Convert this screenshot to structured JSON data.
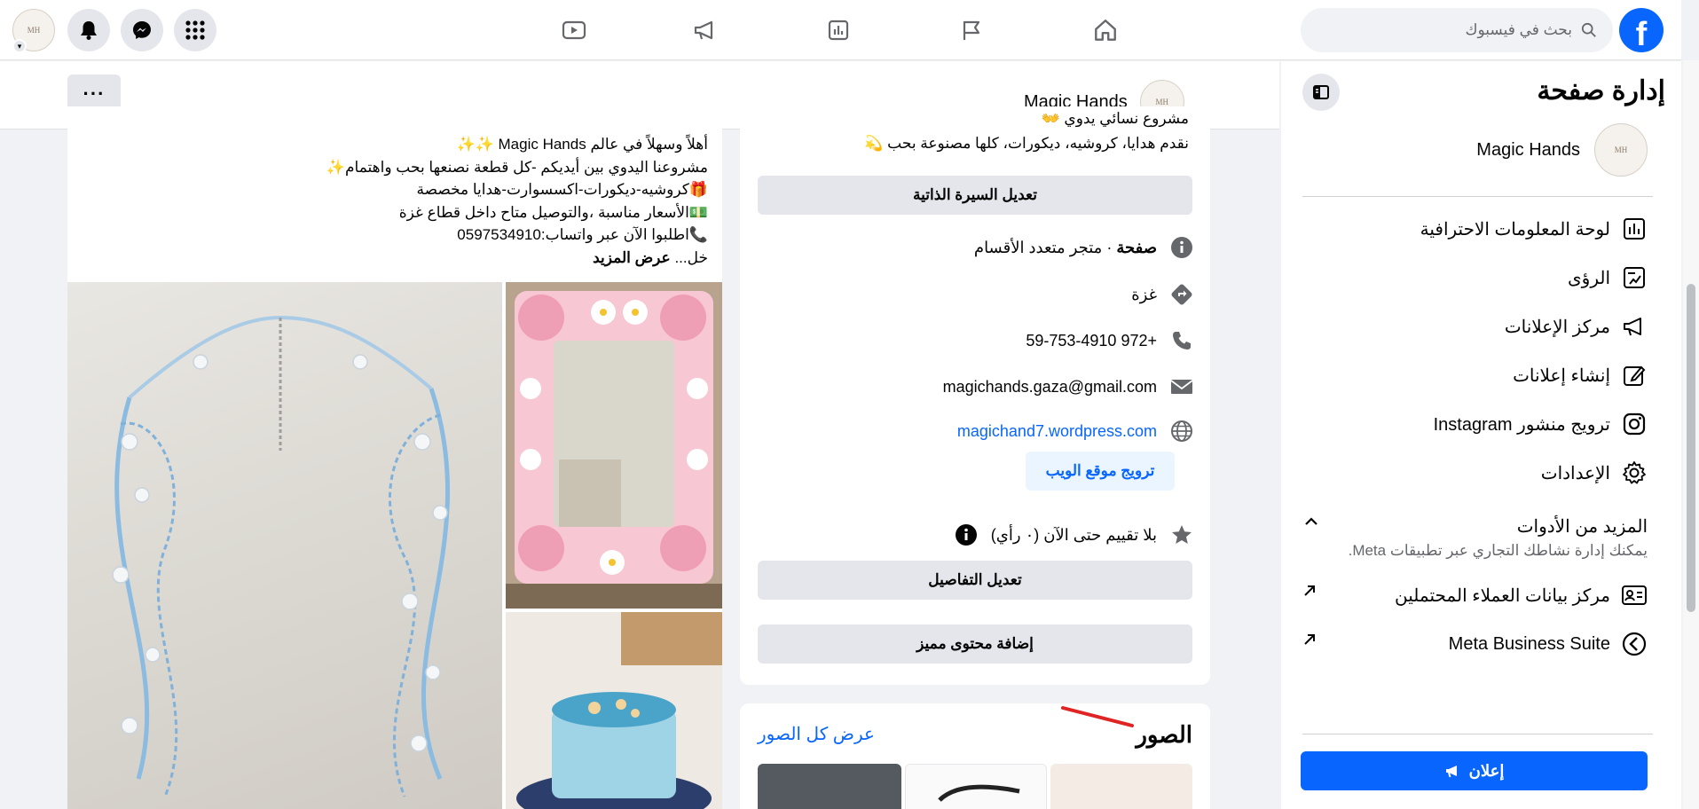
{
  "topbar": {
    "search_placeholder": "بحث في فيسبوك",
    "logo_letter": "f"
  },
  "sidebar": {
    "title": "إدارة صفحة",
    "page_name": "Magic Hands",
    "items": [
      {
        "label": "لوحة المعلومات الاحترافية",
        "icon": "dashboard-icon"
      },
      {
        "label": "الرؤى",
        "icon": "insights-icon"
      },
      {
        "label": "مركز الإعلانات",
        "icon": "megaphone-icon"
      },
      {
        "label": "إنشاء إعلانات",
        "icon": "pencil-icon"
      },
      {
        "label": "ترويج منشور Instagram",
        "icon": "instagram-icon"
      },
      {
        "label": "الإعدادات",
        "icon": "gear-icon"
      }
    ],
    "more_tools_title": "المزيد من الأدوات",
    "more_tools_sub": "يمكنك إدارة نشاطك التجاري عبر تطبيقات Meta.",
    "lead_center": "مركز بيانات العملاء المحتملين",
    "business_suite": "Meta Business Suite",
    "ad_button": "إعلان"
  },
  "page_header": {
    "name": "Magic Hands",
    "more": "···"
  },
  "intro": {
    "bio_line1": "مشروع نسائي يدوي 👐",
    "bio_line2": "نقدم هدايا، كروشيه، ديكورات، كلها مصنوعة بحب 💫",
    "edit_bio": "تعديل السيرة الذاتية",
    "category_prefix": "صفحة",
    "category": " · متجر متعدد الأقسام",
    "location": "غزة",
    "phone": "+972 59-753-4910",
    "email": "magichands.gaza@gmail.com",
    "website": "magichand7.wordpress.com",
    "promote_website": "ترويج موقع الويب",
    "rating": "بلا تقييم حتى الآن (٠ رأي)",
    "edit_details": "تعديل التفاصيل",
    "add_featured": "إضافة محتوى مميز"
  },
  "photos": {
    "title": "الصور",
    "see_all": "عرض كل الصور"
  },
  "post": {
    "lines": [
      "أهلاً وسهلاً في عالم Magic Hands ✨✨",
      "مشروعنا اليدوي بين أيديكم -كل قطعة نصنعها بحب واهتمام✨",
      "🎁كروشيه-ديكورات-اكسسوارت-هدايا مخصصة",
      "💵الأسعار مناسبة ،والتوصيل متاح داخل قطاع غزة",
      "📞اطلبوا الآن عبر واتساب:0597534910"
    ],
    "truncated": "خل...",
    "see_more": "عرض المزيد"
  },
  "colors": {
    "brand": "#0866ff",
    "annotation": "#e02424"
  }
}
